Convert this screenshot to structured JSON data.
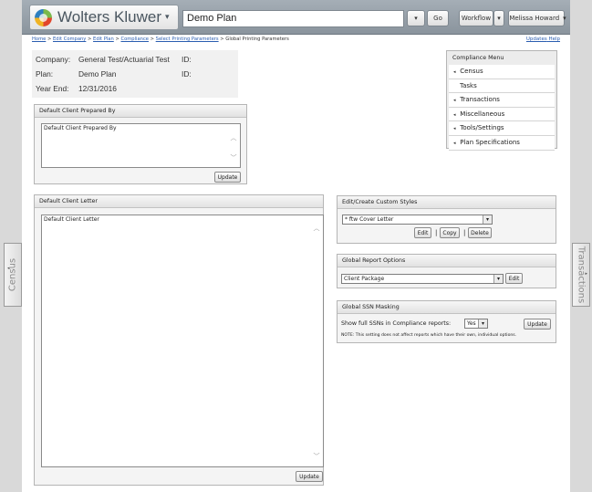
{
  "header": {
    "brand": "Wolters Kluwer",
    "brand_caret": "▾",
    "plan_search_value": "Demo Plan",
    "go_label": "Go",
    "dropdown_caret": "▾",
    "workflow_label": "Workflow",
    "user_name": "Melissa Howard",
    "user_status_color": "#5b8fd0"
  },
  "breadcrumb": {
    "links": [
      "Home",
      "Edit Company",
      "Edit Plan",
      "Compliance",
      "Select Printing Parameters"
    ],
    "separator": ">",
    "current": "Global Printing Parameters"
  },
  "top_links": {
    "updates": "Updates",
    "help": "Help"
  },
  "plan_info": {
    "company_label": "Company:",
    "company_value": "General Test/Actuarial Test",
    "id_label": "ID:",
    "plan_label": "Plan:",
    "plan_value": "Demo Plan",
    "year_end_label": "Year End:",
    "year_end_value": "12/31/2016"
  },
  "prepared_by": {
    "title": "Default Client Prepared By",
    "text": "Default Client Prepared By",
    "update_label": "Update"
  },
  "client_letter": {
    "title": "Default Client Letter",
    "text": "Default Client Letter",
    "update_label": "Update"
  },
  "compliance_menu": {
    "title": "Compliance Menu",
    "items": [
      {
        "label": "Census",
        "expandable": true
      },
      {
        "label": "Tasks",
        "expandable": false
      },
      {
        "label": "Transactions",
        "expandable": true
      },
      {
        "label": "Miscellaneous",
        "expandable": true
      },
      {
        "label": "Tools/Settings",
        "expandable": true
      },
      {
        "label": "Plan Specifications",
        "expandable": true
      }
    ],
    "caret": "◂"
  },
  "custom_styles": {
    "title": "Edit/Create Custom Styles",
    "selected": "* ftw Cover Letter",
    "edit_label": "Edit",
    "copy_label": "Copy",
    "delete_label": "Delete",
    "separator": "|"
  },
  "report_options": {
    "title": "Global Report Options",
    "selected": "Client Package",
    "edit_label": "Edit"
  },
  "ssn_masking": {
    "title": "Global SSN Masking",
    "question": "Show full SSNs in Compliance reports:",
    "selected": "Yes",
    "update_label": "Update",
    "note": "NOTE: This setting does not affect reports which have their own, individual options."
  },
  "side_tabs": {
    "left": "Census",
    "right": "Transactions"
  },
  "scroll": {
    "up": "︿",
    "down": "﹀"
  }
}
